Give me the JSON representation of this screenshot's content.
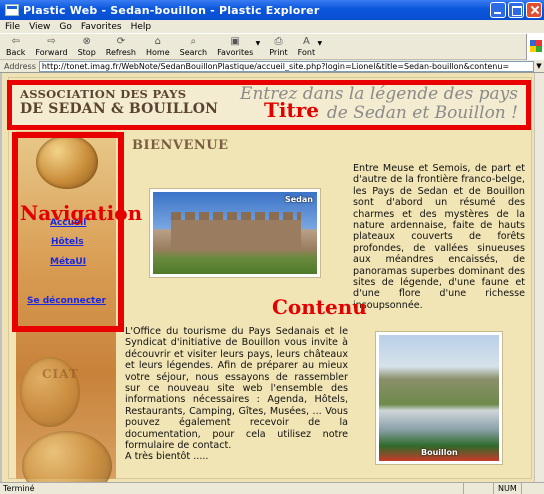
{
  "window": {
    "title": "Plastic Web - Sedan-bouillon - Plastic Explorer"
  },
  "menu": [
    "File",
    "View",
    "Go",
    "Favorites",
    "Help"
  ],
  "toolbar": [
    {
      "label": "Back",
      "icon": "back-arrow-icon",
      "glyph": "⇦"
    },
    {
      "label": "Forward",
      "icon": "forward-arrow-icon",
      "glyph": "⇨"
    },
    {
      "label": "Stop",
      "icon": "stop-icon",
      "glyph": "⊗"
    },
    {
      "label": "Refresh",
      "icon": "refresh-icon",
      "glyph": "⟳"
    },
    {
      "label": "Home",
      "icon": "home-icon",
      "glyph": "⌂"
    },
    {
      "label": "Search",
      "icon": "search-icon",
      "glyph": "⌕"
    },
    {
      "label": "Favorites",
      "icon": "favorites-icon",
      "glyph": "▣"
    },
    {
      "label": "Print",
      "icon": "print-icon",
      "glyph": "⎙"
    },
    {
      "label": "Font",
      "icon": "font-icon",
      "glyph": "A"
    }
  ],
  "address": {
    "label": "Address",
    "url": "http://tonet.imag.fr/WebNote/SedanBouillonPlastique/accueil_site.php?login=Lionel&title=Sedan-bouillon&contenu="
  },
  "page": {
    "banner": {
      "org_line1": "ASSOCIATION DES PAYS",
      "org_line2": "DE SEDAN & BOUILLON",
      "slogan_line1": "Entrez dans la légende des pays",
      "slogan_line2": "de Sedan et Bouillon !"
    },
    "nav": {
      "links": [
        "Accueil",
        "Hôtels",
        "MétaUI"
      ],
      "logout": "Se déconnecter"
    },
    "heading": "BIENVENUE",
    "photo_captions": {
      "sedan": "Sedan",
      "bouillon": "Bouillon"
    },
    "coin_text": "CIAT",
    "intro": "Entre Meuse et Semois, de part et d'autre de la frontière franco-belge, les Pays de Sedan et de Bouillon sont d'abord un résumé des charmes et des mystères de la nature ardennaise, faite de hauts plateaux couverts de forêts profondes, de vallées sinueuses aux méandres encaissés, de panoramas superbes dominant des sites de légende, d'une faune et d'une flore d'une richesse insoupsonnée.",
    "body": "L'Office du tourisme du Pays Sedanais et le Syndicat d'initiative de Bouillon vous invite à découvrir et visiter leurs pays, leurs châteaux et leurs légendes. Afin de préparer au mieux votre séjour, nous essayons de rassembler sur ce nouveau site web l'ensemble des informations nécessaires : Agenda, Hôtels, Restaurants, Camping, Gîtes, Musées, ... Vous pouvez également recevoir de la documentation, pour cela utilisez notre formulaire de contact.",
    "closing": "A très bientôt ....."
  },
  "annotations": {
    "title": "Titre",
    "navigation": "Navigation",
    "content": "Contenu",
    "color": "#e90000"
  },
  "status": {
    "text": "Terminé",
    "mode": "NUM"
  }
}
